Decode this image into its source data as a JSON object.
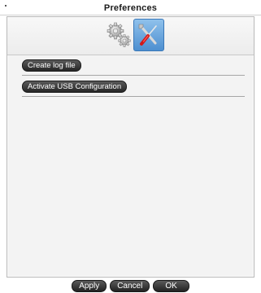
{
  "window": {
    "title": "Preferences"
  },
  "toolbar": {
    "tabs": [
      {
        "icon": "gears-icon",
        "selected": false
      },
      {
        "icon": "tools-icon",
        "selected": true
      }
    ],
    "selected_color": "#4d8fd0"
  },
  "options": [
    {
      "label": "Create log file"
    },
    {
      "label": "Activate USB Configuration"
    }
  ],
  "footer": {
    "apply_label": "Apply",
    "cancel_label": "Cancel",
    "ok_label": "OK"
  }
}
